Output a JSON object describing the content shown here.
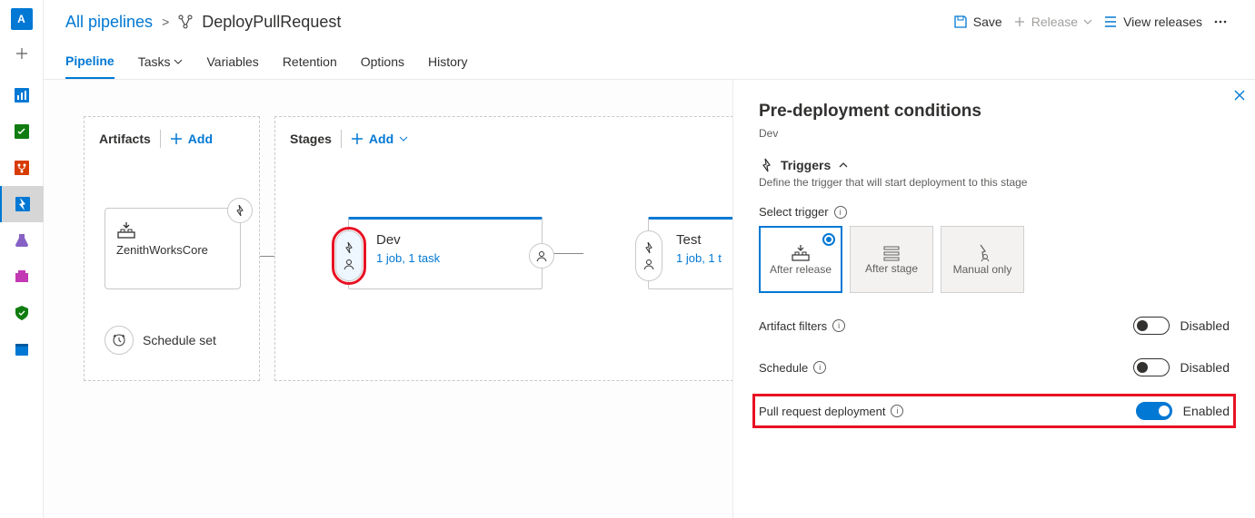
{
  "breadcrumb": {
    "root": "All pipelines",
    "name": "DeployPullRequest"
  },
  "toolbar": {
    "save": "Save",
    "release": "Release",
    "viewReleases": "View releases"
  },
  "tabs": {
    "pipeline": "Pipeline",
    "tasks": "Tasks",
    "variables": "Variables",
    "retention": "Retention",
    "options": "Options",
    "history": "History"
  },
  "artifacts": {
    "title": "Artifacts",
    "add": "Add",
    "card": {
      "name": "ZenithWorksCore"
    },
    "schedule": "Schedule set"
  },
  "stages": {
    "title": "Stages",
    "add": "Add",
    "dev": {
      "name": "Dev",
      "jobs": "1 job, 1 task"
    },
    "test": {
      "name": "Test",
      "jobs": "1 job, 1 t"
    }
  },
  "panel": {
    "title": "Pre-deployment conditions",
    "subtitle": "Dev",
    "triggers": {
      "heading": "Triggers",
      "desc": "Define the trigger that will start deployment to this stage",
      "selectLabel": "Select trigger",
      "afterRelease": "After release",
      "afterStage": "After stage",
      "manualOnly": "Manual only"
    },
    "artifactFilters": {
      "label": "Artifact filters",
      "state": "Disabled"
    },
    "schedule": {
      "label": "Schedule",
      "state": "Disabled"
    },
    "prDeploy": {
      "label": "Pull request deployment",
      "state": "Enabled"
    }
  },
  "avatar": "A"
}
